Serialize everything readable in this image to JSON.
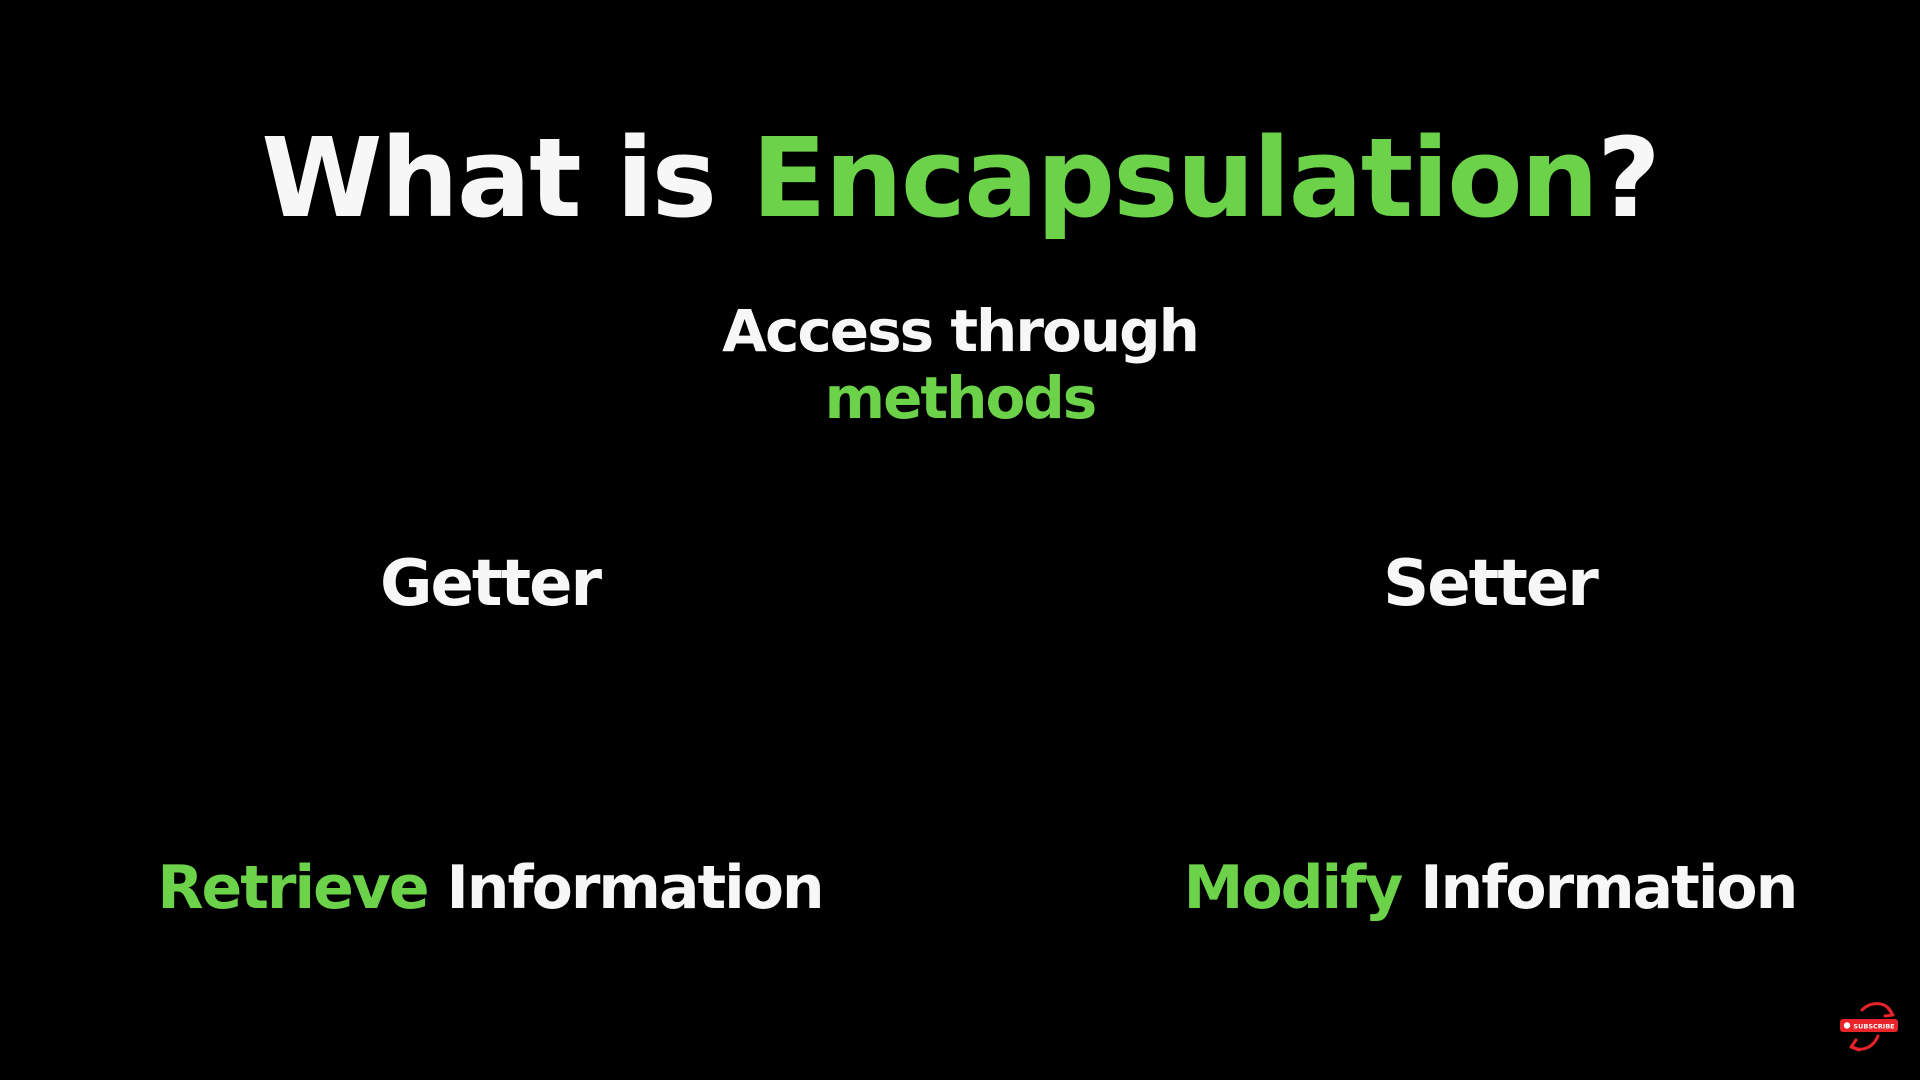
{
  "title": {
    "prefix": "What is ",
    "highlight": "Encapsulation",
    "suffix": "?"
  },
  "subtitle": {
    "line1": "Access through",
    "line2": "methods"
  },
  "left": {
    "label": "Getter",
    "desc_highlight": "Retrieve",
    "desc_rest": " Information"
  },
  "right": {
    "label": "Setter",
    "desc_highlight": "Modify",
    "desc_rest": " Information"
  },
  "watermark": {
    "text": "SUBSCRIBE"
  },
  "colors": {
    "background": "#000000",
    "text": "#f7f7f7",
    "accent": "#6cd24a",
    "subscribe": "#e8232a"
  }
}
